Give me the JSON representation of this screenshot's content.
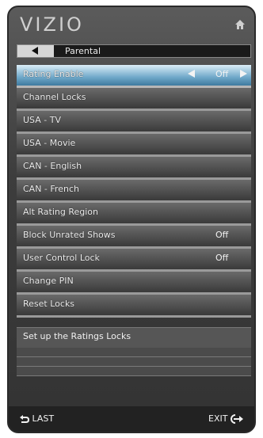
{
  "header": {
    "brand": "VIZIO",
    "home_icon": "home-icon"
  },
  "breadcrumb": {
    "label": "Parental",
    "back_icon": "back-arrow-icon"
  },
  "menu": {
    "items": [
      {
        "label": "Rating Enable",
        "value": "Off",
        "selected": true
      },
      {
        "label": "Channel Locks",
        "value": ""
      },
      {
        "label": "USA - TV",
        "value": ""
      },
      {
        "label": "USA - Movie",
        "value": ""
      },
      {
        "label": "CAN - English",
        "value": ""
      },
      {
        "label": "CAN - French",
        "value": ""
      },
      {
        "label": "Alt Rating Region",
        "value": ""
      },
      {
        "label": "Block Unrated Shows",
        "value": "Off"
      },
      {
        "label": "User Control Lock",
        "value": "Off"
      },
      {
        "label": "Change PIN",
        "value": ""
      },
      {
        "label": "Reset Locks",
        "value": ""
      }
    ]
  },
  "help": {
    "text": "Set up the Ratings Locks"
  },
  "footer": {
    "last_label": "LAST",
    "exit_label": "EXIT",
    "last_icon": "return-arrow-icon",
    "exit_icon": "exit-arrow-icon"
  },
  "colors": {
    "selected_top": "#dbeef7",
    "selected_bottom": "#3f7a9f",
    "panel": "#3d3d3d"
  }
}
